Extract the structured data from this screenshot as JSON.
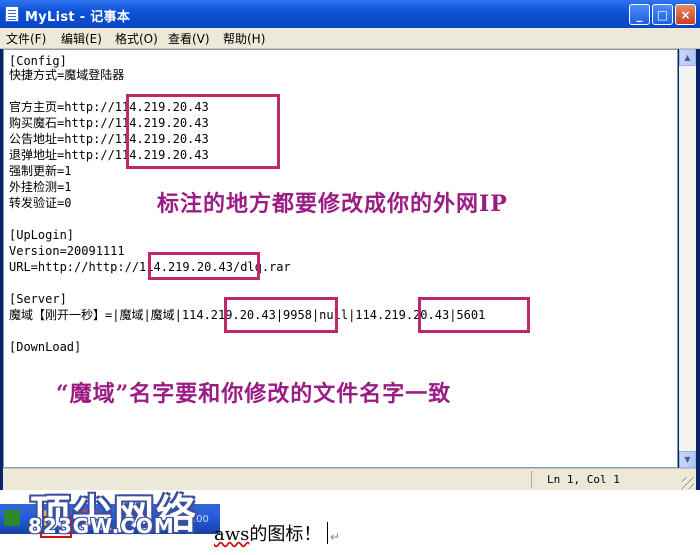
{
  "window": {
    "title": "MyList - 记事本",
    "buttons": {
      "minimize": "_",
      "maximize": "□",
      "close": "×"
    }
  },
  "menu": [
    "文件(F)",
    "编辑(E)",
    "格式(O)",
    "查看(V)",
    "帮助(H)"
  ],
  "editor": {
    "lines": [
      "[Config]",
      "快捷方式=魔域登陆器",
      "",
      "官方主页=http://114.219.20.43",
      "购买魔石=http://114.219.20.43",
      "公告地址=http://114.219.20.43",
      "退弹地址=http://114.219.20.43",
      "强制更新=1",
      "外挂检测=1",
      "转发验证=0",
      "",
      "[UpLogin]",
      "Version=20091111",
      "URL=http://http://114.219.20.43/dlq.rar",
      "",
      "[Server]",
      "魔域【刚开一秒】=|魔域|魔域|114.219.20.43|9958|null|114.219.20.43|5601",
      "",
      "[DownLoad]"
    ]
  },
  "annotations": {
    "ip_note": "标注的地方都要修改成你的外网IP",
    "name_note": "“魔域”名字要和你修改的文件名字一致"
  },
  "statusbar": {
    "position": "Ln 1, Col 1"
  },
  "watermark": {
    "main": "顶尖网络",
    "sub": "823GW.COM"
  },
  "footer": {
    "text_before": "aws",
    "text_after": "的图标！",
    "tray_time": "12:00"
  }
}
